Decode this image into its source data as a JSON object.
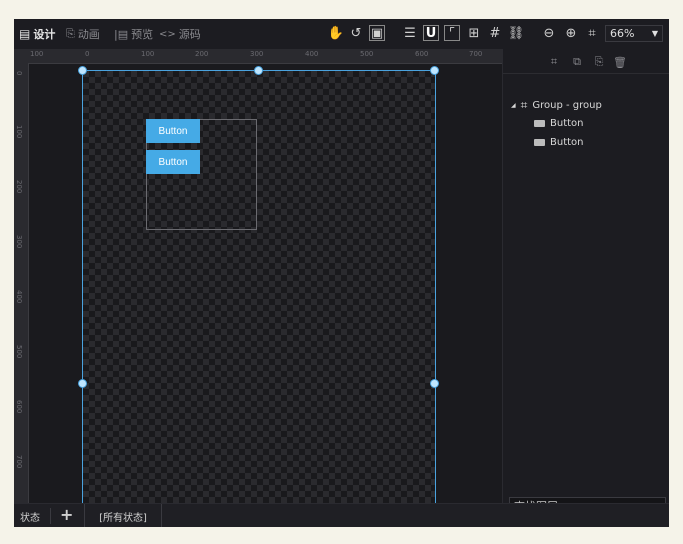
{
  "toolbar": {
    "design_label": "设计",
    "animation_label": "动画",
    "preview_label": "预览",
    "source_label": "源码",
    "zoom_value": "66%",
    "icons": [
      "hand-icon",
      "rotate-icon",
      "fit-artboard-icon",
      "layers-stack-icon",
      "magnet-icon",
      "align-icon",
      "grid-icon",
      "hash-grid-icon",
      "link-icon",
      "zoom-out-icon",
      "zoom-in-icon",
      "fit-screen-icon"
    ]
  },
  "ruler": {
    "h_ticks": [
      "100",
      "0",
      "100",
      "200",
      "300",
      "400",
      "500",
      "600",
      "700"
    ],
    "v_ticks": [
      "0",
      "100",
      "200",
      "300",
      "400",
      "500",
      "600",
      "700"
    ]
  },
  "canvas": {
    "buttons": [
      {
        "label": "Button"
      },
      {
        "label": "Button"
      }
    ]
  },
  "layers": {
    "group_label": "Group - group",
    "items": [
      {
        "label": "Button"
      },
      {
        "label": "Button"
      }
    ]
  },
  "search": {
    "placeholder": "查找图层",
    "clear_label": "×"
  },
  "statusbar": {
    "state_label": "状态",
    "add_label": "+",
    "all_states_label": "[所有状态]"
  },
  "colors": {
    "accent": "#4aa3df",
    "button": "#45aae6",
    "background": "#1b1b1f"
  }
}
